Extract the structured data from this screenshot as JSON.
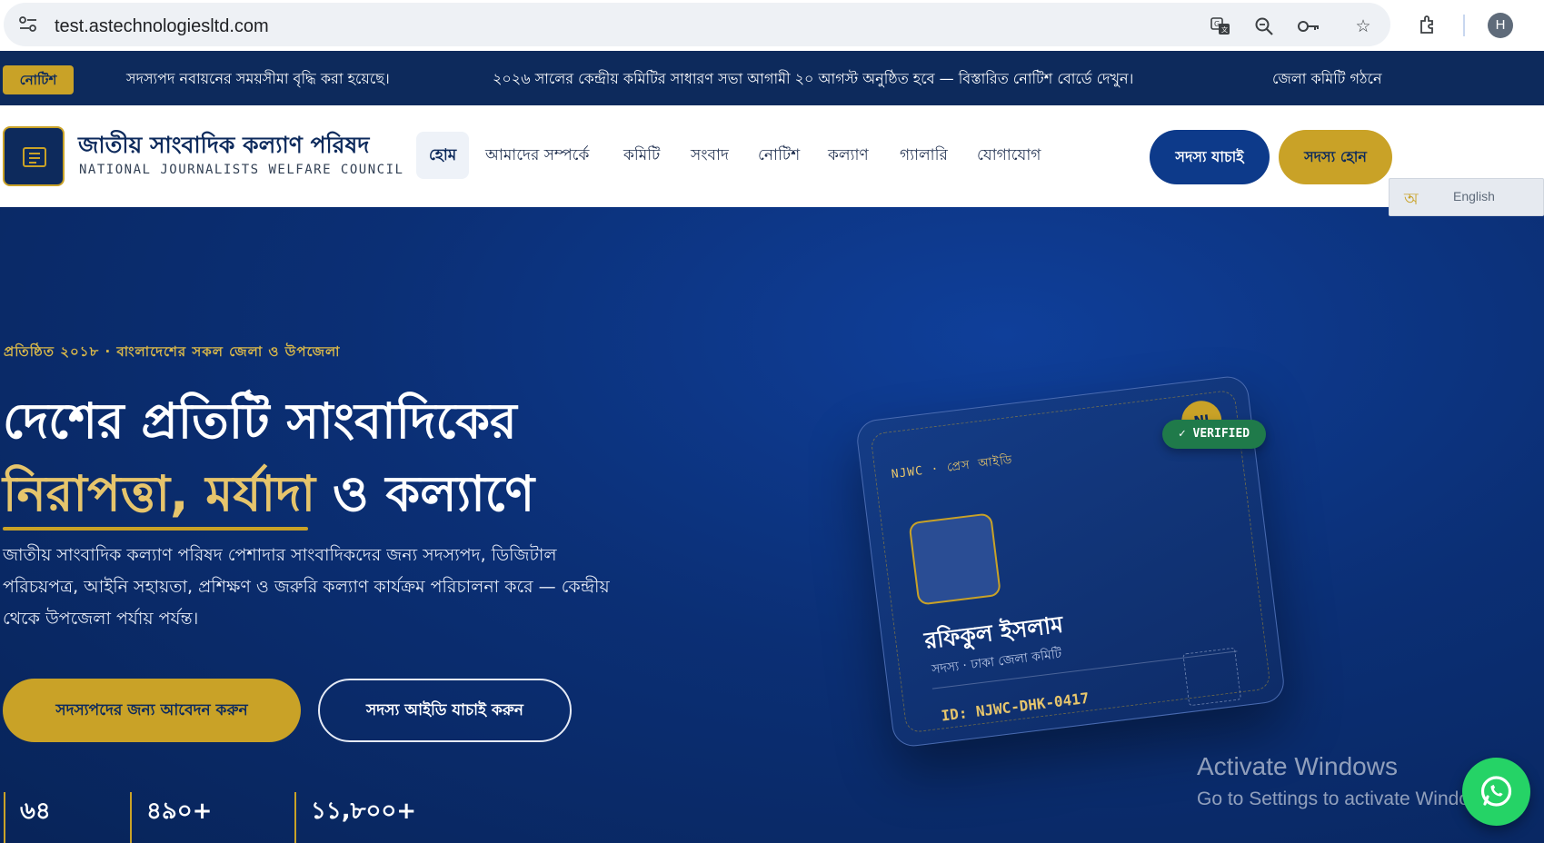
{
  "browser": {
    "url": "test.astechnologiesltd.com",
    "profile_initial": "H",
    "icons": [
      "site-info-icon",
      "translate-icon",
      "zoom-icon",
      "password-key-icon",
      "bookmark-star-icon",
      "extensions-icon"
    ]
  },
  "ticker": {
    "badge": "নোটিশ",
    "items": [
      "সদস্যপদ নবায়নের সময়সীমা বৃদ্ধি করা হয়েছে।",
      "২০২৬ সালের কেন্দ্রীয় কমিটির সাধারণ সভা আগামী ২০ আগস্ট অনুষ্ঠিত হবে — বিস্তারিত নোটিশ বোর্ডে দেখুন।",
      "জেলা কমিটি গঠনে"
    ]
  },
  "header": {
    "title_bn": "জাতীয় সাংবাদিক কল্যাণ পরিষদ",
    "title_en": "NATIONAL JOURNALISTS WELFARE COUNCIL",
    "nav": [
      "হোম",
      "আমাদের সম্পর্কে",
      "কমিটি",
      "সংবাদ",
      "নোটিশ",
      "কল্যাণ",
      "গ্যালারি",
      "যোগাযোগ"
    ],
    "active_nav": "হোম",
    "verify_button": "সদস্য যাচাই",
    "join_button": "সদস্য হোন"
  },
  "language_switch": {
    "bn": "অ",
    "en": "English"
  },
  "hero": {
    "eyebrow": "প্রতিষ্ঠিত ২০১৮ · বাংলাদেশের সকল জেলা ও উপজেলা",
    "headline_line1": "দেশের প্রতিটি সাংবাদিকের",
    "headline_gold": "নিরাপত্তা, মর্যাদা",
    "headline_rest": " ও কল্যাণে",
    "lead": "জাতীয় সাংবাদিক কল্যাণ পরিষদ পেশাদার সাংবাদিকদের জন্য সদস্যপদ, ডিজিটাল পরিচয়পত্র, আইনি সহায়তা, প্রশিক্ষণ ও জরুরি কল্যাণ কার্যক্রম পরিচালনা করে — কেন্দ্রীয় থেকে উপজেলা পর্যায় পর্যন্ত।",
    "cta_apply": "সদস্যপদের জন্য আবেদন করুন",
    "cta_verify": "সদস্য আইডি যাচাই করুন",
    "stats": [
      "৬৪",
      "৪৯০+",
      "১১,৮০০+"
    ]
  },
  "id_card": {
    "label": "NJWC · প্রেস আইডি",
    "coin": "NJ",
    "verified": "✓ VERIFIED",
    "name": "রফিকুল ইসলাম",
    "role": "সদস্য · ঢাকা জেলা কমিটি",
    "id": "ID: NJWC-DHK-0417"
  },
  "watermark": {
    "title": "Activate Windows",
    "subtitle": "Go to Settings to activate Windows."
  },
  "colors": {
    "navy": "#0d2a5c",
    "gold": "#c9a227",
    "light_gold": "#e6c56c",
    "hero_blue": "#0b2f75",
    "whatsapp": "#25d366"
  }
}
